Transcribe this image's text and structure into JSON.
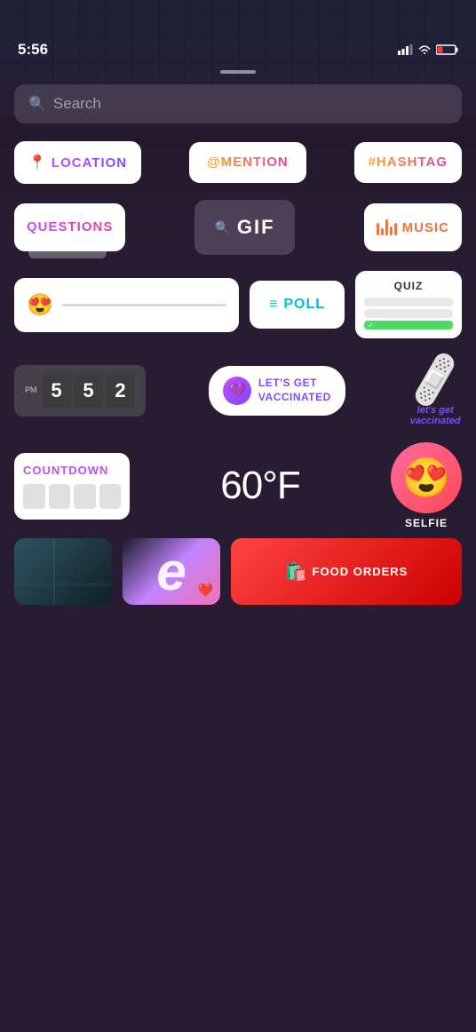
{
  "statusBar": {
    "time": "5:56",
    "signalIcon": "signal-bars",
    "wifiIcon": "wifi",
    "batteryIcon": "battery-low"
  },
  "searchBar": {
    "placeholder": "Search"
  },
  "stickers": {
    "row1": [
      {
        "id": "location",
        "label": "LOCATION",
        "icon": "📍",
        "iconColor": "#c44bff"
      },
      {
        "id": "mention",
        "label": "@MENTION"
      },
      {
        "id": "hashtag",
        "label": "#HASHTAG"
      }
    ],
    "row2": [
      {
        "id": "questions",
        "label": "QUESTIONS"
      },
      {
        "id": "gif",
        "label": "GIF",
        "searchPrefix": "🔍"
      },
      {
        "id": "music",
        "label": "MUSIC"
      }
    ],
    "row3": [
      {
        "id": "emoji-slider",
        "emoji": "😍"
      },
      {
        "id": "poll",
        "label": "POLL"
      },
      {
        "id": "quiz",
        "label": "QUIZ"
      }
    ],
    "row4": [
      {
        "id": "clock",
        "pm": "PM",
        "digits": [
          "5",
          "5",
          "2"
        ]
      },
      {
        "id": "vaccinated",
        "label": "LET'S GET\nVACCINATED"
      },
      {
        "id": "vacc-animated",
        "text": "let's get\nvaccinated"
      }
    ],
    "row5": [
      {
        "id": "countdown",
        "label": "COUNTDOWN"
      },
      {
        "id": "weather",
        "label": "60°F"
      },
      {
        "id": "selfie",
        "label": "SELFIE"
      }
    ],
    "bottomRow": [
      {
        "id": "map"
      },
      {
        "id": "e-logo"
      },
      {
        "id": "food-orders",
        "label": "FOOD ORDERS"
      }
    ]
  }
}
